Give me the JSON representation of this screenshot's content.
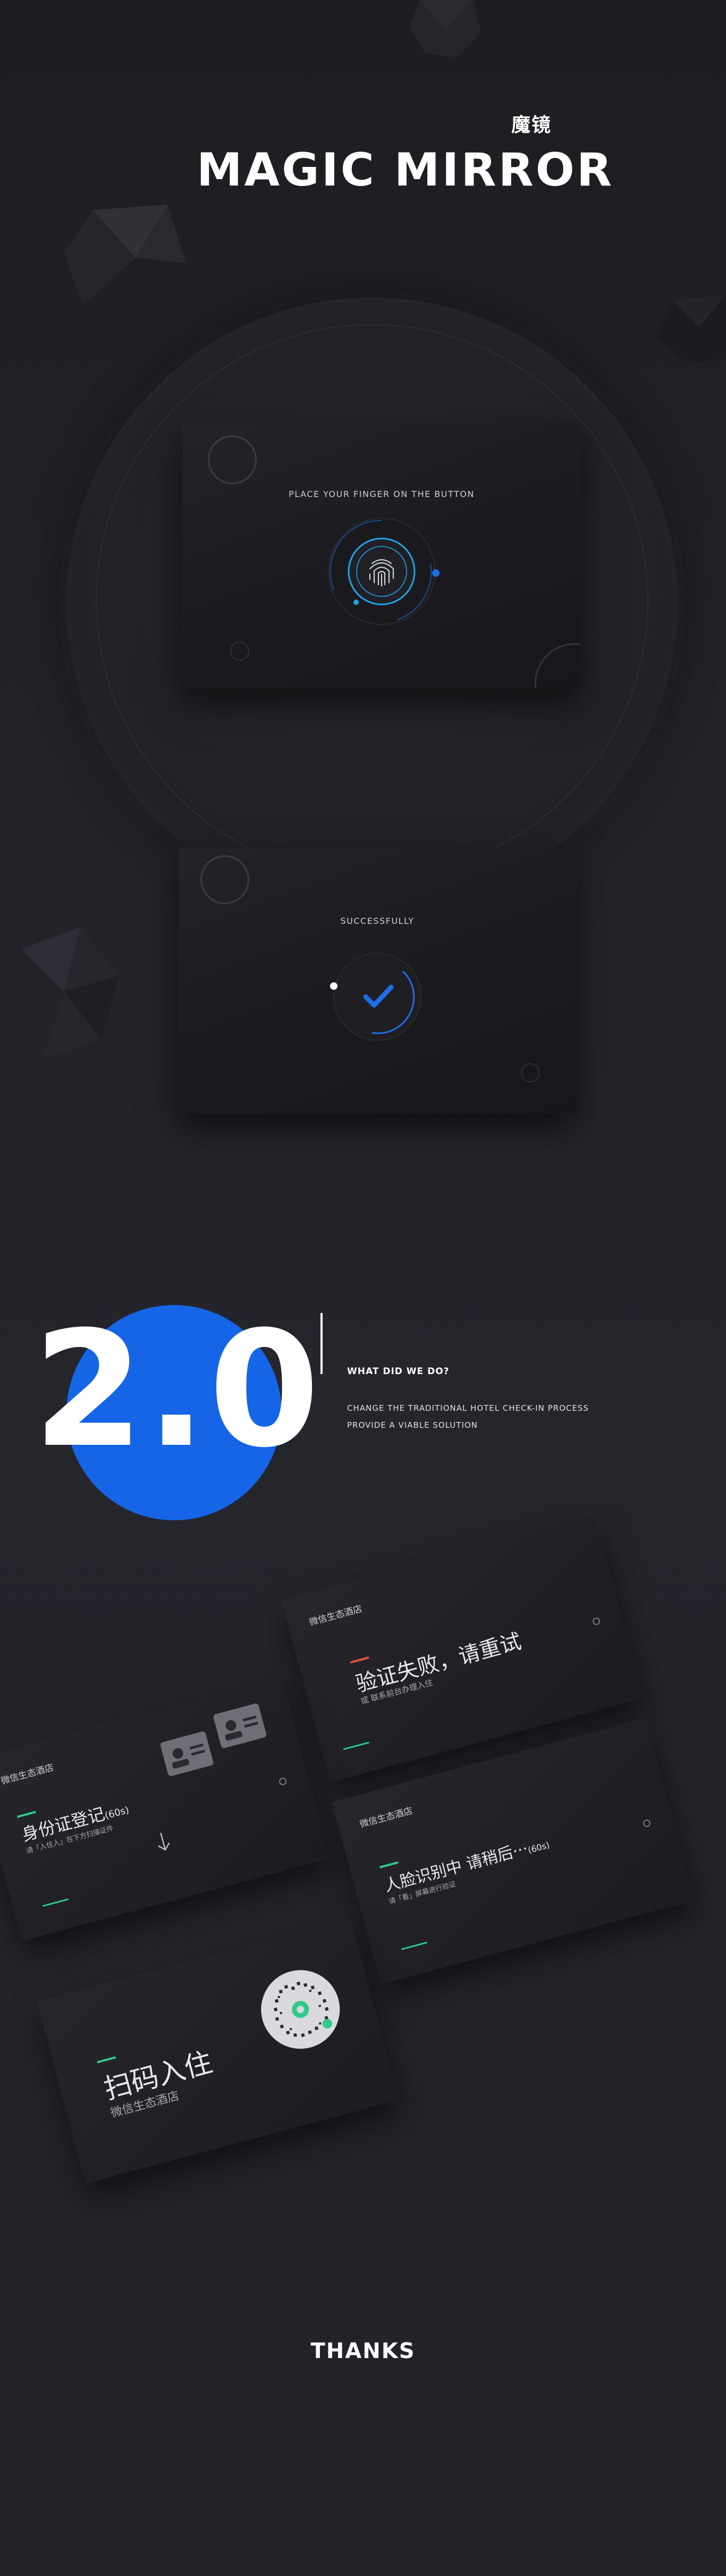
{
  "header": {
    "title_cn": "魔镜",
    "title_en": "MAGIC MIRROR"
  },
  "screen1": {
    "caption": "PLACE YOUR FINGER ON THE BUTTON",
    "icon": "fingerprint-icon"
  },
  "screen2": {
    "caption": "SUCCESSFULLY",
    "icon": "check-icon"
  },
  "version": {
    "number": "2.0",
    "heading": "WHAT DID WE DO?",
    "lines": [
      "CHANGE THE TRADITIONAL HOTEL CHECK-IN PROCESS",
      "PROVIDE A VIABLE SOLUTION"
    ]
  },
  "cards": {
    "fail": {
      "brand": "微信生态酒店",
      "title": "验证失败，请重试",
      "sub": "或 联系前台办理入住"
    },
    "id": {
      "brand": "微信生态酒店",
      "title": "身份证登记",
      "title_suffix": "(60s)",
      "sub": "请「入住人」在下方扫描证件"
    },
    "face": {
      "brand": "微信生态酒店",
      "title": "人脸识别中 请稍后···",
      "title_suffix": "(60s)",
      "sub": "请「看」屏幕进行验证"
    },
    "scan": {
      "title": "扫码入住",
      "sub": "微信生态酒店"
    }
  },
  "footer": {
    "thanks": "THANKS"
  },
  "colors": {
    "accent_blue": "#1565e6",
    "accent_red": "#e5533d",
    "accent_green": "#2fc98a"
  }
}
